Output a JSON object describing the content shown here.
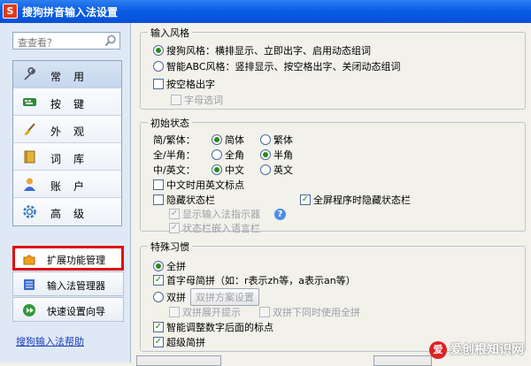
{
  "window": {
    "title": "搜狗拼音输入法设置",
    "icon_letter": "S"
  },
  "sidebar": {
    "search_placeholder": "查查看？",
    "items": [
      {
        "label": "常用",
        "icon": "wrench-icon",
        "active": true
      },
      {
        "label": "按键",
        "icon": "keyboard-icon"
      },
      {
        "label": "外观",
        "icon": "brush-icon"
      },
      {
        "label": "词库",
        "icon": "book-icon"
      },
      {
        "label": "账户",
        "icon": "user-icon"
      },
      {
        "label": "高级",
        "icon": "gear-icon"
      }
    ],
    "tools": [
      {
        "label": "扩展功能管理",
        "icon": "puzzle-icon",
        "highlighted": true
      },
      {
        "label": "输入法管理器",
        "icon": "list-icon"
      },
      {
        "label": "快速设置向导",
        "icon": "wizard-icon"
      }
    ],
    "help_link": "搜狗输入法帮助"
  },
  "input_style": {
    "title": "输入风格",
    "option_sogou": "搜狗风格：横排显示、立即出字、启用动态组词",
    "option_abc": "智能ABC风格：竖排显示、按空格出字、关闭动态组词",
    "space_output": "按空格出字",
    "letter_select": "字母选词"
  },
  "initial_state": {
    "title": "初始状态",
    "simp_trad_label": "简/繁体：",
    "simp": "简体",
    "trad": "繁体",
    "width_label": "全/半角：",
    "full": "全角",
    "half": "半角",
    "lang_label": "中/英文：",
    "chinese": "中文",
    "english": "英文",
    "cn_en_punct": "中文时用英文标点",
    "hide_status": "隐藏状态栏",
    "hide_fullscreen": "全屏程序时隐藏状态栏",
    "show_indicator": "显示输入法指示器",
    "embed_language_bar": "状态栏嵌入语言栏",
    "info": "?"
  },
  "special_habits": {
    "title": "特殊习惯",
    "full_pinyin": "全拼",
    "initial_abbrev": "首字母简拼（如：r表示zh等，a表示an等）",
    "double_pinyin": "双拼",
    "scheme_button": "双拼方案设置",
    "double_expand_hint": "双拼展开提示",
    "double_with_full": "双拼下同时使用全拼",
    "smart_punct": "智能调整数字后面的标点",
    "super_abbrev": "超级简拼"
  },
  "watermark": {
    "badge": "爱",
    "text": "爱创根知识网"
  },
  "colors": {
    "titlebar": "#0a5ee6",
    "highlight_border": "#e10d0d",
    "link": "#1a3fb8"
  }
}
